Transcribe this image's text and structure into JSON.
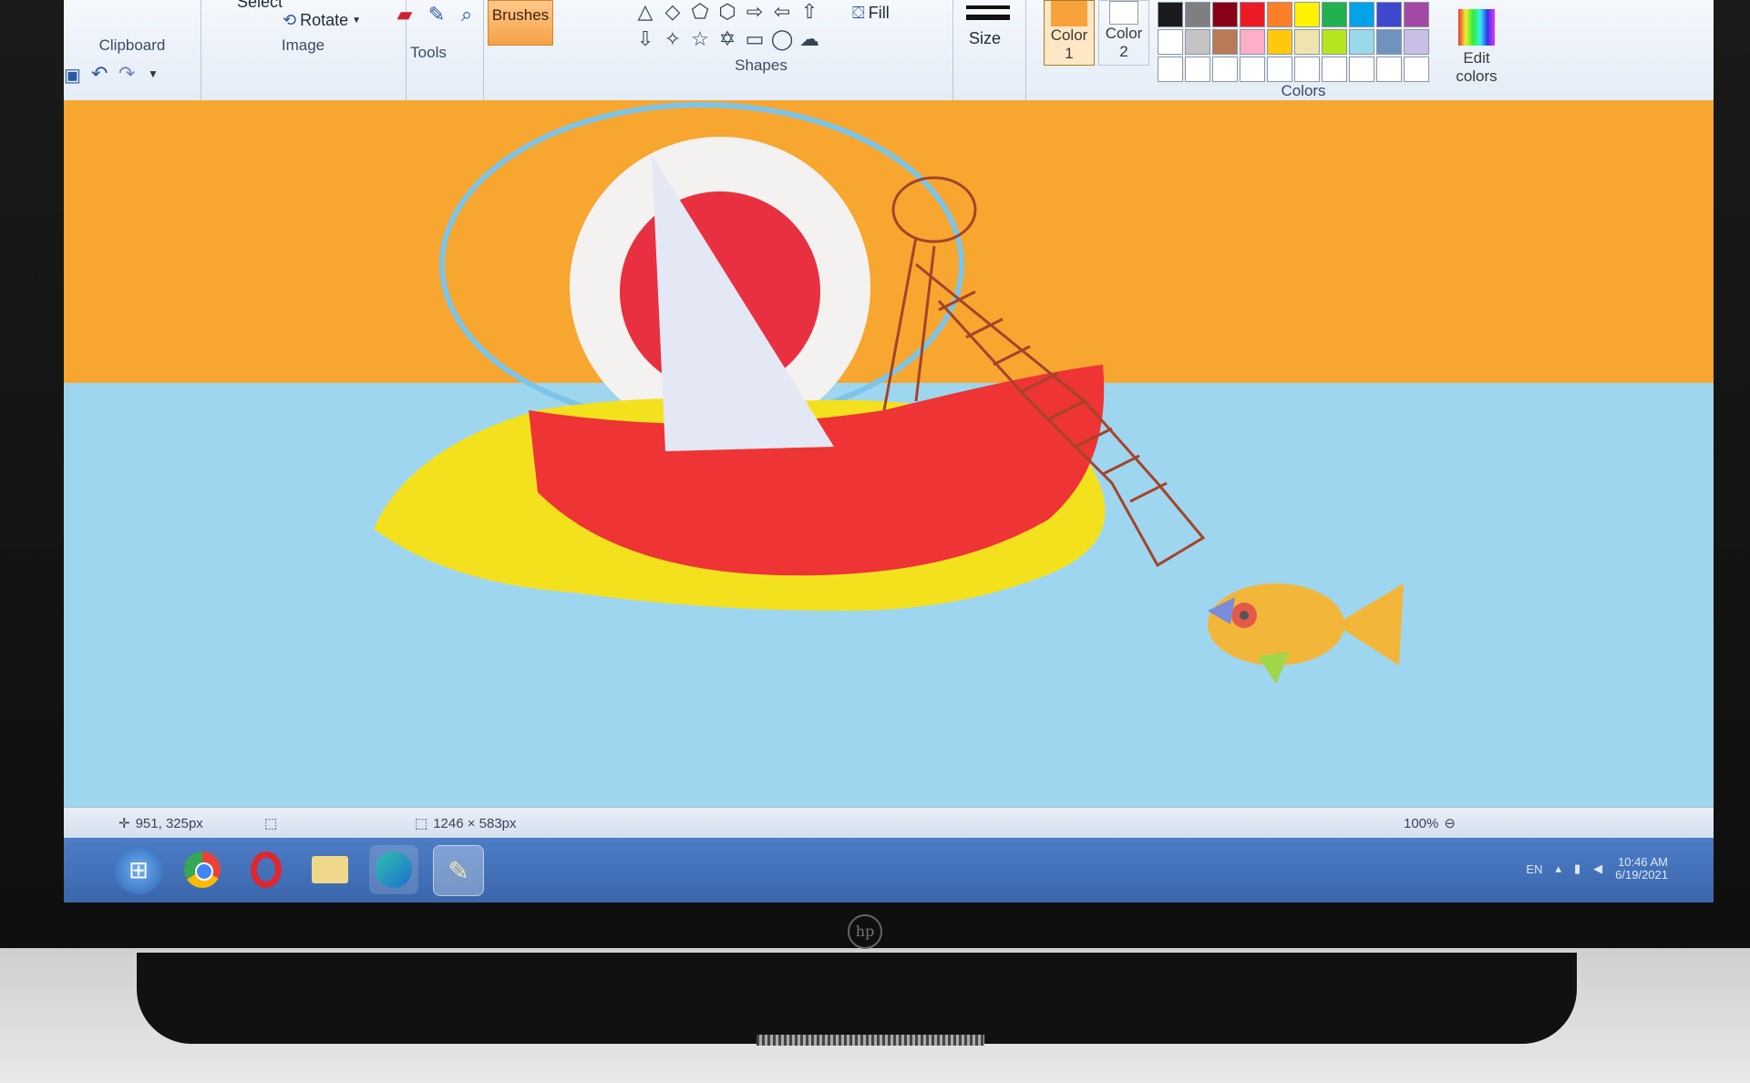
{
  "ribbon": {
    "clipboard_label": "Clipboard",
    "select_label": "Select",
    "rotate_label": "Rotate",
    "image_label": "Image",
    "tools_label": "Tools",
    "brushes_label": "Brushes",
    "fill_label": "Fill",
    "shapes_label": "Shapes",
    "size_label": "Size",
    "color1_label": "Color 1",
    "color2_label": "Color 2",
    "edit_colors_label": "Edit colors",
    "colors_label": "Colors",
    "palette_row1": [
      "#1b1b1b",
      "#7f7f7f",
      "#880015",
      "#ed1c24",
      "#ff7f27",
      "#fff200",
      "#22b14c",
      "#00a2e8",
      "#3f48cc",
      "#a349a4"
    ],
    "palette_row2": [
      "#ffffff",
      "#c3c3c3",
      "#b97a57",
      "#ffaec9",
      "#ffc90e",
      "#efe4b0",
      "#b5e61d",
      "#99d9ea",
      "#7092be",
      "#c8bfe7"
    ],
    "color1_value": "#f7a23a",
    "color2_value": "#ffffff"
  },
  "status": {
    "cursor_pos": "951, 325px",
    "image_size": "1246 × 583px",
    "zoom": "100%"
  },
  "taskbar": {
    "apps": [
      "start-orb",
      "chrome",
      "opera",
      "file-explorer",
      "edge",
      "paint"
    ],
    "tray_lang": "EN",
    "tray_time": "10:46 AM",
    "tray_date": "6/19/2021"
  },
  "colors": {
    "sky": "#f7a630",
    "sea": "#9fd6ef",
    "boat": "#ee3434",
    "sand": "#f4e11e",
    "sun_red": "#e93040",
    "sail": "#e4e7f4",
    "fish": "#f2b73a",
    "net": "#a3442b"
  }
}
